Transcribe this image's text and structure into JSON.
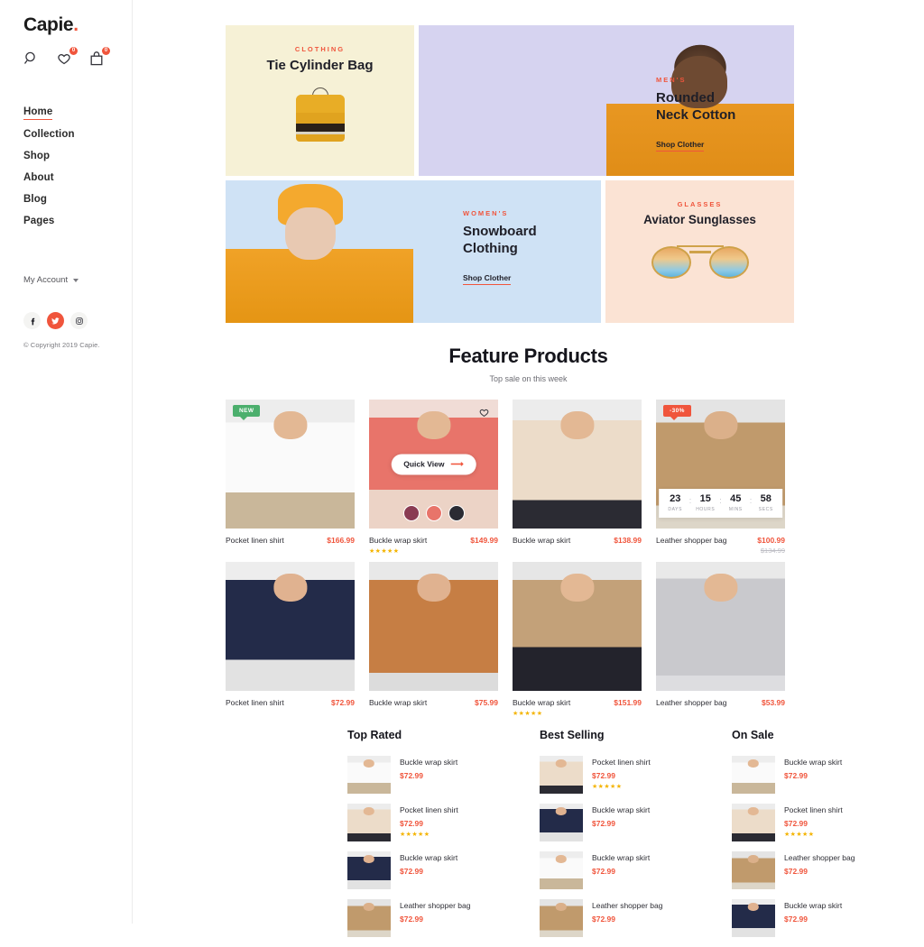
{
  "sidebar": {
    "logo": "Capie",
    "logo_dot": ".",
    "icons": [
      {
        "name": "search-icon",
        "badge": null
      },
      {
        "name": "wishlist-heart-icon",
        "badge": "0"
      },
      {
        "name": "cart-bag-icon",
        "badge": "0"
      }
    ],
    "nav": [
      {
        "label": "Home",
        "active": true
      },
      {
        "label": "Collection",
        "active": false
      },
      {
        "label": "Shop",
        "active": false
      },
      {
        "label": "About",
        "active": false
      },
      {
        "label": "Blog",
        "active": false
      },
      {
        "label": "Pages",
        "active": false
      }
    ],
    "account_label": "My Account",
    "socials": [
      "facebook-icon",
      "twitter-icon",
      "instagram-icon"
    ],
    "copyright": "© Copyright 2019 Capie."
  },
  "hero": {
    "banners": [
      {
        "eyebrow": "CLOTHING",
        "title": "Tie Cylinder Bag",
        "link": null,
        "bg": "#f6f1d6"
      },
      {
        "eyebrow": "MEN'S",
        "title_line1": "Rounded",
        "title_line2": "Neck Cotton",
        "link": "Shop Clother",
        "bg": "#d6d3f0"
      },
      {
        "eyebrow": "WOMEN'S",
        "title_line1": "Snowboard",
        "title_line2": "Clothing",
        "link": "Shop Clother",
        "bg": "#cfe2f5"
      },
      {
        "eyebrow": "GLASSES",
        "title": "Aviator Sunglasses",
        "link": null,
        "bg": "#fbe3d4"
      }
    ]
  },
  "feature": {
    "title": "Feature Products",
    "subtitle": "Top sale on this week",
    "row1": [
      {
        "name": "Pocket linen shirt",
        "price": "$166.99",
        "badge": "NEW",
        "badge_type": "new",
        "fig": "white"
      },
      {
        "name": "Buckle wrap skirt",
        "price": "$149.99",
        "stars": "★★★★★",
        "quick_view": "Quick View",
        "wishlist": true,
        "swatches": [
          "#8a3b52",
          "#e8746a",
          "#2b2b33"
        ],
        "fig": "pink"
      },
      {
        "name": "Buckle wrap skirt",
        "price": "$138.99",
        "fig": "beige"
      },
      {
        "name": "Leather shopper bag",
        "price": "$100.99",
        "old_price": "$134.99",
        "badge": "-30%",
        "badge_type": "sale",
        "timer": [
          {
            "num": "23",
            "label": "DAYS"
          },
          {
            "num": "15",
            "label": "HOURS"
          },
          {
            "num": "45",
            "label": "MINS"
          },
          {
            "num": "58",
            "label": "SECS"
          }
        ],
        "fig": "tan"
      }
    ],
    "row2": [
      {
        "name": "Pocket linen shirt",
        "price": "$72.99",
        "fig": "navy"
      },
      {
        "name": "Buckle wrap skirt",
        "price": "$75.99",
        "fig": "camel"
      },
      {
        "name": "Buckle wrap skirt",
        "price": "$151.99",
        "stars": "★★★★★",
        "fig": "trench"
      },
      {
        "name": "Leather shopper bag",
        "price": "$53.99",
        "fig": "grey"
      }
    ]
  },
  "lists": [
    {
      "title": "Top Rated",
      "items": [
        {
          "name": "Buckle wrap skirt",
          "price": "$72.99",
          "fig": "white"
        },
        {
          "name": "Pocket linen shirt",
          "price": "$72.99",
          "stars": "★★★★★",
          "fig": "beige"
        },
        {
          "name": "Buckle wrap skirt",
          "price": "$72.99",
          "fig": "navy"
        },
        {
          "name": "Leather shopper bag",
          "price": "$72.99",
          "fig": "tan"
        }
      ]
    },
    {
      "title": "Best Selling",
      "items": [
        {
          "name": "Pocket linen shirt",
          "price": "$72.99",
          "stars": "★★★★★",
          "fig": "beige"
        },
        {
          "name": "Buckle wrap skirt",
          "price": "$72.99",
          "fig": "navy"
        },
        {
          "name": "Buckle wrap skirt",
          "price": "$72.99",
          "fig": "white"
        },
        {
          "name": "Leather shopper bag",
          "price": "$72.99",
          "fig": "tan"
        }
      ]
    },
    {
      "title": "On Sale",
      "items": [
        {
          "name": "Buckle wrap skirt",
          "price": "$72.99",
          "fig": "white"
        },
        {
          "name": "Pocket linen shirt",
          "price": "$72.99",
          "stars": "★★★★★",
          "fig": "beige"
        },
        {
          "name": "Leather shopper bag",
          "price": "$72.99",
          "fig": "tan"
        },
        {
          "name": "Buckle wrap skirt",
          "price": "$72.99",
          "fig": "navy"
        }
      ]
    }
  ],
  "colors": {
    "accent": "#f0553c",
    "new_badge": "#4caf6d",
    "star": "#f4b400",
    "text": "#2e2e35"
  }
}
